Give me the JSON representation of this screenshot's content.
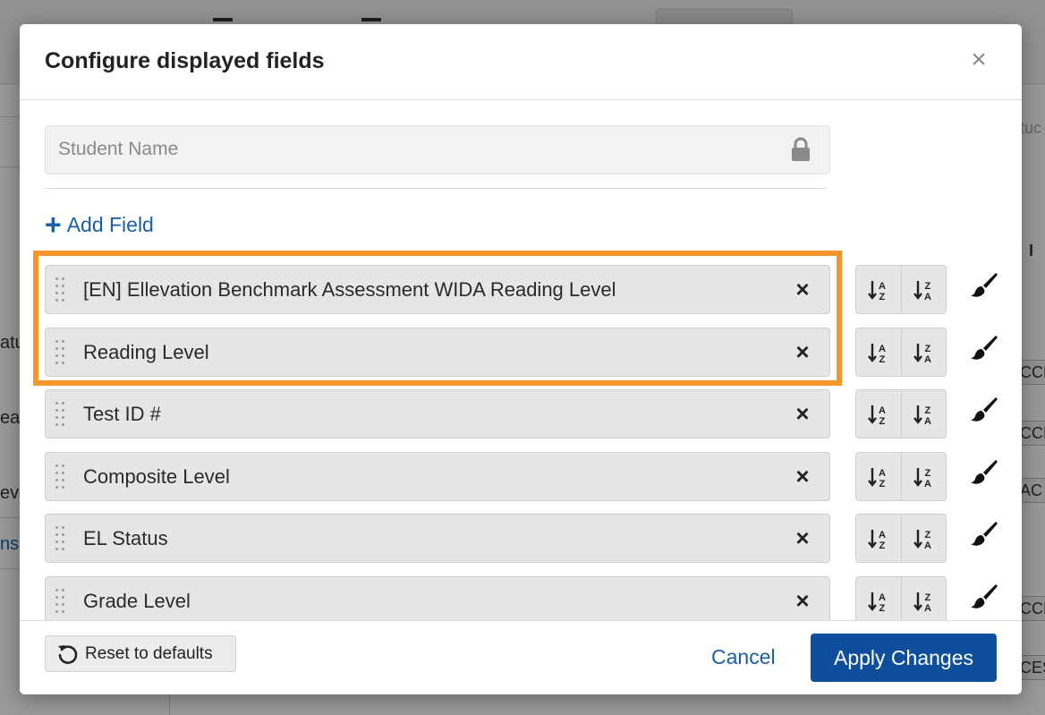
{
  "background": {
    "sidebar_partial_texts": [
      "atu",
      "ea",
      "eve",
      "ns"
    ],
    "right_partial_texts": [
      "tuc",
      "I",
      "CCE",
      "CCE",
      "AC",
      "CCE",
      "CES"
    ]
  },
  "modal": {
    "title": "Configure displayed fields",
    "close_label": "×",
    "locked_field": {
      "label": "Student Name",
      "icon": "lock-icon"
    },
    "add_field_label": "Add Field",
    "fields": [
      {
        "label": "[EN] Ellevation Benchmark Assessment WIDA Reading Level",
        "highlighted": true
      },
      {
        "label": "Reading Level",
        "highlighted": true
      },
      {
        "label": "Test ID #",
        "highlighted": false
      },
      {
        "label": "Composite Level",
        "highlighted": false
      },
      {
        "label": "EL Status",
        "highlighted": false
      },
      {
        "label": "Grade Level",
        "highlighted": false
      }
    ],
    "remove_icon": "×",
    "sort_asc_icon": "sort-a-z-icon",
    "sort_desc_icon": "sort-z-a-icon",
    "style_icon": "paintbrush-icon",
    "highlight_color": "#f7962a",
    "footer": {
      "reset_label": "Reset to defaults",
      "cancel_label": "Cancel",
      "apply_label": "Apply Changes"
    },
    "accent_color": "#0e4e9c"
  }
}
